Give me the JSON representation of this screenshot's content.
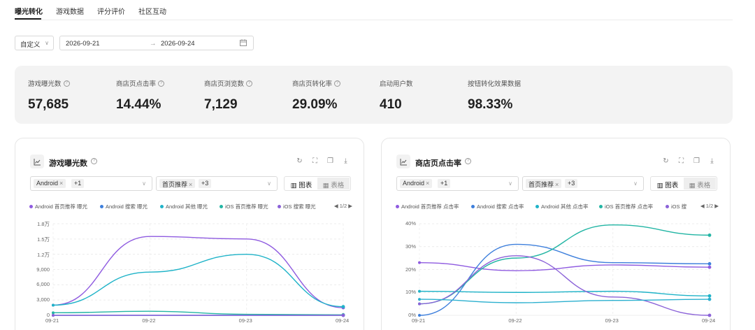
{
  "tabs": [
    {
      "label": "曝光转化",
      "active": true
    },
    {
      "label": "游戏数据",
      "active": false
    },
    {
      "label": "评分评价",
      "active": false
    },
    {
      "label": "社区互动",
      "active": false
    }
  ],
  "filters": {
    "range_mode": "自定义",
    "start_date": "2026-09-21",
    "arrow": "→",
    "end_date": "2026-09-24"
  },
  "kpis": [
    {
      "label": "游戏曝光数",
      "value": "57,685",
      "help": true
    },
    {
      "label": "商店页点击率",
      "value": "14.44%",
      "help": true
    },
    {
      "label": "商店页浏览数",
      "value": "7,129",
      "help": true
    },
    {
      "label": "商店页转化率",
      "value": "29.09%",
      "help": true
    },
    {
      "label": "启动用户数",
      "value": "410",
      "help": false
    },
    {
      "label": "按钮转化效果数据",
      "value": "98.33%",
      "help": false
    }
  ],
  "cards": [
    {
      "title": "游戏曝光数",
      "platform_chip": "Android",
      "platform_more": "+1",
      "source_chip": "首页推荐",
      "source_more": "+3",
      "toggle_chart": "图表",
      "toggle_table": "表格",
      "legend": [
        {
          "name": "Android 首页推荐 曝光",
          "color": "#8f5be0"
        },
        {
          "name": "Android 搜索 曝光",
          "color": "#3d7fdc"
        },
        {
          "name": "Android 其他 曝光",
          "color": "#1fb3c8"
        },
        {
          "name": "iOS 首页推荐 曝光",
          "color": "#22b5a4"
        },
        {
          "name": "iOS 搜索 曝光",
          "color": "#8b62d8"
        }
      ],
      "legend_page": "1/2",
      "chart_data": {
        "type": "line",
        "x": [
          "09-21",
          "09-22",
          "09-23",
          "09-24"
        ],
        "y_ticks": [
          "0",
          "3,000",
          "6,000",
          "9,000",
          "1.2万",
          "1.5万",
          "1.8万"
        ],
        "ylim": [
          0,
          18000
        ],
        "series": [
          {
            "name": "Android 首页推荐 曝光",
            "color": "#8f5be0",
            "values": [
              2000,
              15500,
              15000,
              1500
            ]
          },
          {
            "name": "Android 搜索 曝光",
            "color": "#3d7fdc",
            "values": [
              0,
              0,
              0,
              0
            ]
          },
          {
            "name": "Android 其他 曝光",
            "color": "#1fb3c8",
            "values": [
              2000,
              8500,
              12000,
              1700
            ]
          },
          {
            "name": "iOS 首页推荐 曝光",
            "color": "#22b5a4",
            "values": [
              500,
              800,
              200,
              100
            ]
          },
          {
            "name": "iOS 搜索 曝光",
            "color": "#8b62d8",
            "values": [
              0,
              0,
              0,
              0
            ]
          }
        ]
      }
    },
    {
      "title": "商店页点击率",
      "platform_chip": "Android",
      "platform_more": "+1",
      "source_chip": "首页推荐",
      "source_more": "+3",
      "toggle_chart": "图表",
      "toggle_table": "表格",
      "legend": [
        {
          "name": "Android 首页推荐 点击率",
          "color": "#8f5be0"
        },
        {
          "name": "Android 搜索 点击率",
          "color": "#3d7fdc"
        },
        {
          "name": "Android 其他 点击率",
          "color": "#1fb3c8"
        },
        {
          "name": "iOS 首页推荐 点击率",
          "color": "#22b5a4"
        },
        {
          "name": "iOS 搜",
          "color": "#8b62d8"
        }
      ],
      "legend_page": "1/2",
      "chart_data": {
        "type": "line",
        "x": [
          "09-21",
          "09-22",
          "09-23",
          "09-24"
        ],
        "y_ticks": [
          "0%",
          "10%",
          "20%",
          "30%",
          "40%"
        ],
        "ylim": [
          0,
          40
        ],
        "series": [
          {
            "name": "Android 首页推荐 点击率",
            "color": "#8f5be0",
            "values": [
              23,
              19.5,
              22,
              21
            ]
          },
          {
            "name": "Android 搜索 点击率",
            "color": "#3d7fdc",
            "values": [
              0,
              31,
              23,
              22.5
            ]
          },
          {
            "name": "Android 其他 点击率",
            "color": "#1fb3c8",
            "values": [
              10.5,
              10,
              10.5,
              8.5
            ]
          },
          {
            "name": "iOS 首页推荐 点击率",
            "color": "#22b5a4",
            "values": [
              5,
              25,
              39.5,
              35
            ]
          },
          {
            "name": "iOS 搜索 点击率",
            "color": "#8b62d8",
            "values": [
              5,
              26,
              8,
              0
            ]
          },
          {
            "name": "",
            "color": "#2cb0cf",
            "values": [
              7,
              5.5,
              6.5,
              7
            ]
          }
        ]
      }
    }
  ]
}
